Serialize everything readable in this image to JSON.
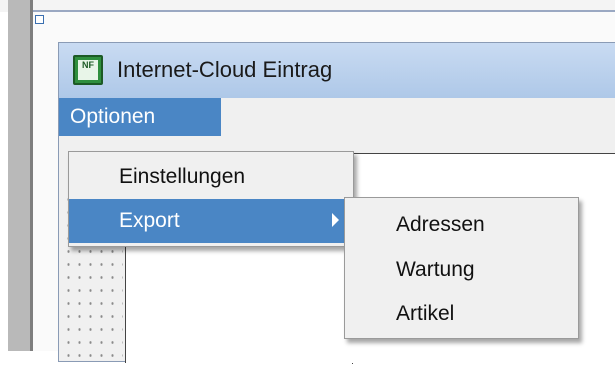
{
  "window": {
    "title": "Internet-Cloud Eintrag",
    "icon": "app-form-icon",
    "icon_text": "NF"
  },
  "menubar": {
    "items": [
      {
        "label": "Optionen",
        "state": "open"
      }
    ]
  },
  "dropdown": {
    "items": [
      {
        "label": "Einstellungen",
        "has_submenu": false
      },
      {
        "label": "Export",
        "has_submenu": true,
        "highlighted": true
      }
    ]
  },
  "submenu": {
    "items": [
      {
        "label": "Adressen"
      },
      {
        "label": "Wartung"
      },
      {
        "label": "Artikel"
      }
    ]
  },
  "colors": {
    "highlight": "#4a86c5",
    "titlebar": "#b8d0ec",
    "menu_bg": "#f0f0f0"
  }
}
